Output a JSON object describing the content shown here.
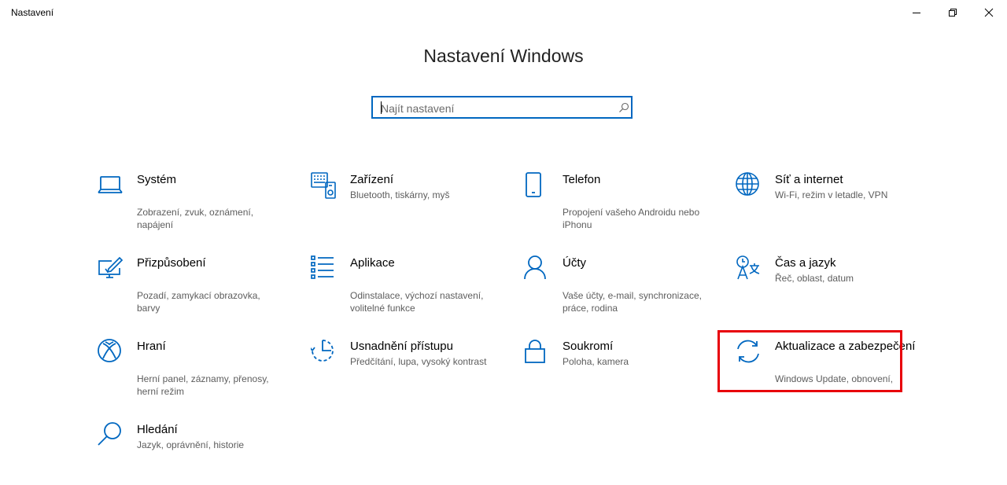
{
  "window": {
    "title": "Nastavení",
    "minimize_icon": "minimize-icon",
    "restore_icon": "restore-icon",
    "close_icon": "close-icon"
  },
  "page": {
    "title": "Nastavení Windows"
  },
  "search": {
    "placeholder": "Najít nastavení",
    "value": "",
    "icon": "search-icon"
  },
  "accent_color": "#0067c0",
  "highlight_color": "#e8000b",
  "categories": [
    {
      "title": "Systém",
      "description": "Zobrazení, zvuk, oznámení, napájení",
      "icon": "laptop-icon"
    },
    {
      "title": "Zařízení",
      "description": "Bluetooth, tiskárny, myš",
      "icon": "devices-icon"
    },
    {
      "title": "Telefon",
      "description": "Propojení vašeho Androidu nebo iPhonu",
      "icon": "phone-icon"
    },
    {
      "title": "Síť a internet",
      "description": "Wi-Fi, režim v letadle, VPN",
      "icon": "globe-icon"
    },
    {
      "title": "Přizpůsobení",
      "description": "Pozadí, zamykací obrazovka, barvy",
      "icon": "personalization-icon"
    },
    {
      "title": "Aplikace",
      "description": "Odinstalace, výchozí nastavení, volitelné funkce",
      "icon": "apps-list-icon"
    },
    {
      "title": "Účty",
      "description": "Vaše účty, e-mail, synchronizace, práce, rodina",
      "icon": "person-icon"
    },
    {
      "title": "Čas a jazyk",
      "description": "Řeč, oblast, datum",
      "icon": "time-language-icon"
    },
    {
      "title": "Hraní",
      "description": "Herní panel, záznamy, přenosy, herní režim",
      "icon": "xbox-icon"
    },
    {
      "title": "Usnadnění přístupu",
      "description": "Předčítání, lupa, vysoký kontrast",
      "icon": "ease-of-access-icon"
    },
    {
      "title": "Soukromí",
      "description": "Poloha, kamera",
      "icon": "lock-icon"
    },
    {
      "title": "Aktualizace a zabezpečení",
      "description": "Windows Update, obnovení,",
      "icon": "sync-icon",
      "highlighted": true
    },
    {
      "title": "Hledání",
      "description": "Jazyk, oprávnění, historie",
      "icon": "search-icon"
    }
  ]
}
